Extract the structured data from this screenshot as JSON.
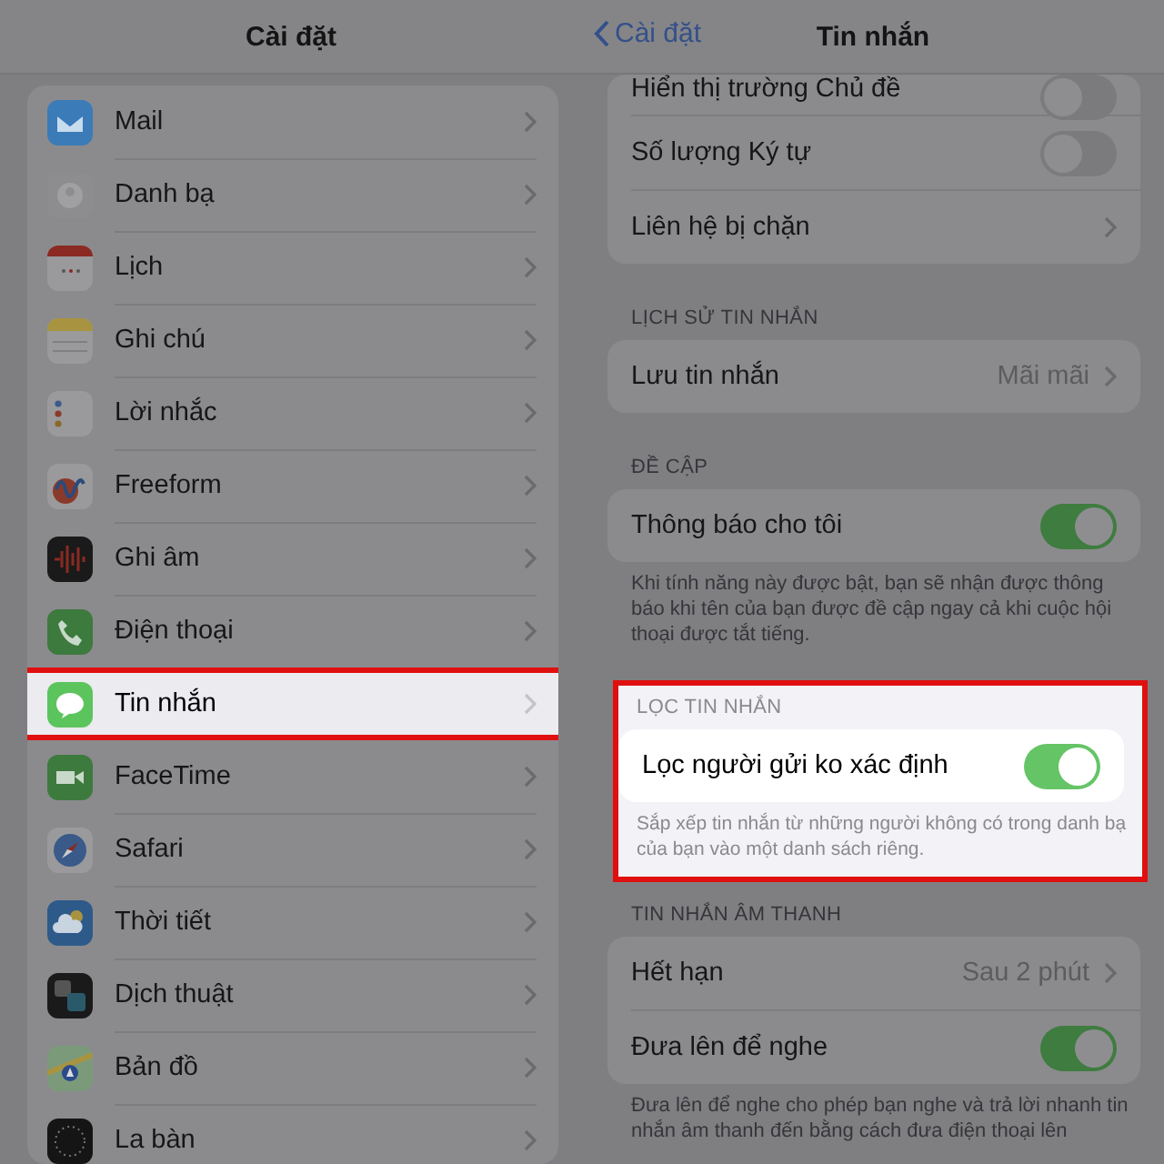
{
  "settings_panel": {
    "title": "Cài đặt",
    "items": [
      {
        "label": "Mail",
        "highlighted": false
      },
      {
        "label": "Danh bạ",
        "highlighted": false
      },
      {
        "label": "Lịch",
        "highlighted": false
      },
      {
        "label": "Ghi chú",
        "highlighted": false
      },
      {
        "label": "Lời nhắc",
        "highlighted": false
      },
      {
        "label": "Freeform",
        "highlighted": false
      },
      {
        "label": "Ghi âm",
        "highlighted": false
      },
      {
        "label": "Điện thoại",
        "highlighted": false
      },
      {
        "label": "Tin nhắn",
        "highlighted": true
      },
      {
        "label": "FaceTime",
        "highlighted": false
      },
      {
        "label": "Safari",
        "highlighted": false
      },
      {
        "label": "Thời tiết",
        "highlighted": false
      },
      {
        "label": "Dịch thuật",
        "highlighted": false
      },
      {
        "label": "Bản đồ",
        "highlighted": false
      },
      {
        "label": "La bàn",
        "highlighted": false
      }
    ]
  },
  "messages_panel": {
    "back": "Cài đặt",
    "title": "Tin nhắn",
    "groups": [
      {
        "highlighted": false,
        "rows": [
          {
            "kind": "toggle",
            "label": "Hiển thị trường Chủ đề",
            "on": false
          },
          {
            "kind": "toggle",
            "label": "Số lượng Ký tự",
            "on": false
          },
          {
            "kind": "link",
            "label": "Liên hệ bị chặn"
          }
        ]
      },
      {
        "highlighted": false,
        "header": "LỊCH SỬ TIN NHẮN",
        "rows": [
          {
            "kind": "link",
            "label": "Lưu tin nhắn",
            "value": "Mãi mãi"
          }
        ]
      },
      {
        "highlighted": false,
        "header": "ĐỀ CẬP",
        "rows": [
          {
            "kind": "toggle",
            "label": "Thông báo cho tôi",
            "on": true
          }
        ],
        "footer": "Khi tính năng này được bật, bạn sẽ nhận được thông báo khi tên của bạn được đề cập ngay cả khi cuộc hội thoại được tắt tiếng."
      },
      {
        "highlighted": true,
        "header": "LỌC TIN NHẮN",
        "rows": [
          {
            "kind": "toggle",
            "label": "Lọc người gửi ko xác định",
            "on": true
          }
        ],
        "footer": "Sắp xếp tin nhắn từ những người không có trong danh bạ của bạn vào một danh sách riêng."
      },
      {
        "highlighted": false,
        "header": "TIN NHẮN ÂM THANH",
        "rows": [
          {
            "kind": "link",
            "label": "Hết hạn",
            "value": "Sau 2 phút"
          },
          {
            "kind": "toggle",
            "label": "Đưa lên để nghe",
            "on": true
          }
        ],
        "footer": "Đưa lên để nghe cho phép bạn nghe và trả lời nhanh tin nhắn âm thanh đến bằng cách đưa điện thoại lên"
      }
    ]
  }
}
